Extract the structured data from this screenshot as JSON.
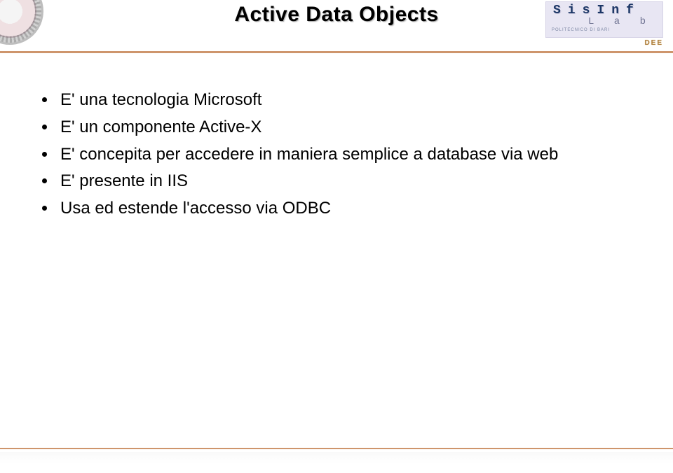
{
  "header": {
    "title": "Active Data Objects"
  },
  "logo": {
    "line1": "SisInf",
    "line2": "L a b",
    "line3": "POLITECNICO DI BARI",
    "dept": "DEE"
  },
  "bullets": [
    "E' una tecnologia Microsoft",
    "E' un componente Active-X",
    "E' concepita per accedere in maniera semplice a database via web",
    "E' presente in IIS",
    "Usa ed estende l'accesso via ODBC"
  ]
}
